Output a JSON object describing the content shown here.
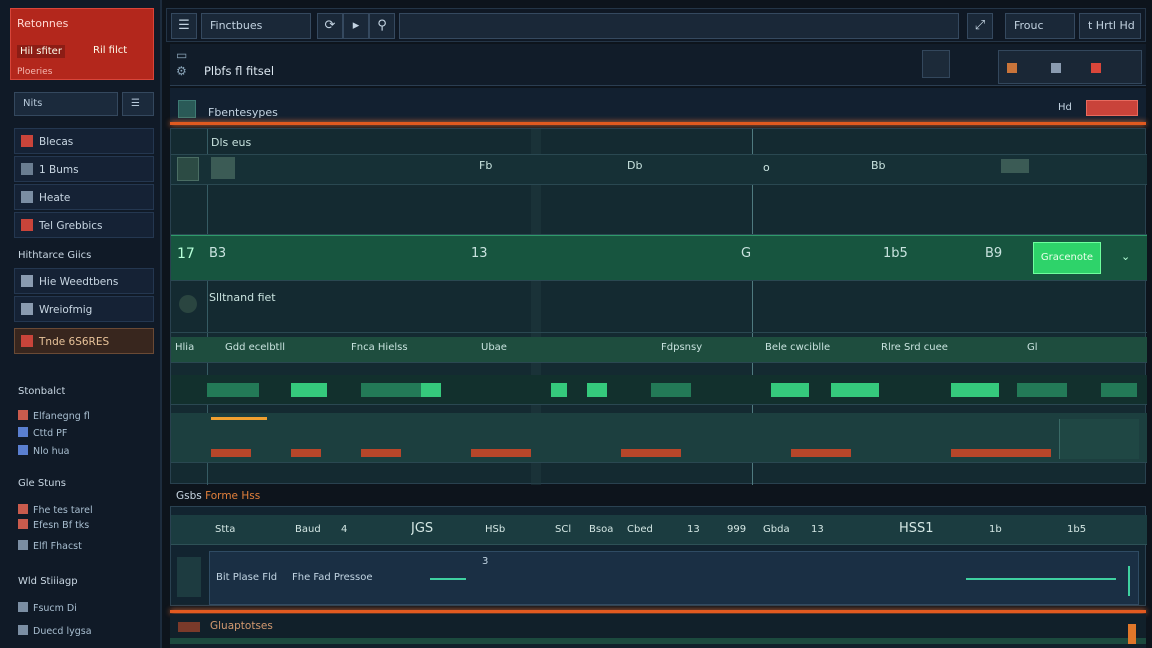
{
  "sidebar": {
    "header": {
      "title": "Retonnes",
      "label": "Hil sfiter",
      "badge": "Ril filct",
      "sub": "Ploeries"
    },
    "tabs": [
      "Nits"
    ],
    "items": [
      {
        "label": "Blecas",
        "selected": false
      },
      {
        "label": "1 Bums",
        "selected": false
      },
      {
        "label": "Heate",
        "selected": false
      },
      {
        "label": "Tel Grebbics",
        "selected": false
      },
      {
        "label": "Hie Weedtbens",
        "selected": false
      },
      {
        "label": "Wreiofmig",
        "selected": false
      },
      {
        "label": "Tnde 6S6RES",
        "selected": true
      }
    ],
    "section_above": "Hithtarce Giics",
    "sections": [
      {
        "title": "Stonbalct",
        "subs": [
          "Elfanegng fl",
          "Cttd PF",
          "Nlo  hua"
        ]
      },
      {
        "title": "Gle Stuns",
        "subs": [
          "Fhe tes tarel",
          "Efesn Bf tks",
          "Elfl Fhacst"
        ]
      },
      {
        "title": "Wld Stiiiagp",
        "subs": [
          "Fsucm Di",
          "Duecd lygsa"
        ]
      }
    ]
  },
  "toolbar": {
    "workspace": "Finctbues",
    "right_label": "Frouc",
    "right_badge": "t Hrtl Hd"
  },
  "header": {
    "title": "Plbfs fl fitsel"
  },
  "pane": {
    "title": "Fbentesypes",
    "right_text": "Hd"
  },
  "grid": {
    "row1_label": "Dls eus",
    "row1_values": [
      "Fb",
      "Db",
      "o",
      "Bb"
    ],
    "row3_value": "17",
    "row3_cells": [
      "B3",
      "13",
      "G",
      "1b5",
      "B9"
    ],
    "row3_button": "Gracenote",
    "row4_label": "Slltnand fiet",
    "header_cells": [
      "Hlia",
      "Gdd ecelbtll",
      "Fnca Hielss",
      "Ubae",
      "Fdpsnsy",
      "Bele cwciblle",
      "Rlre Srd cuee",
      "Gl"
    ]
  },
  "table": {
    "title": "Gsbs",
    "title_accent": "Forme Hss",
    "headers": [
      "Stta",
      "Baud",
      "4",
      "JGS",
      "HSb",
      "SCl",
      "Bsoa",
      "Cbed",
      "13",
      "999",
      "Gbda",
      "13",
      "HSS1",
      "1b",
      "1b5"
    ],
    "row": [
      "Bit Plase Fld",
      "Fhe Fad Pressoe",
      "3"
    ]
  },
  "footer": {
    "label": "Gluaptotses"
  }
}
